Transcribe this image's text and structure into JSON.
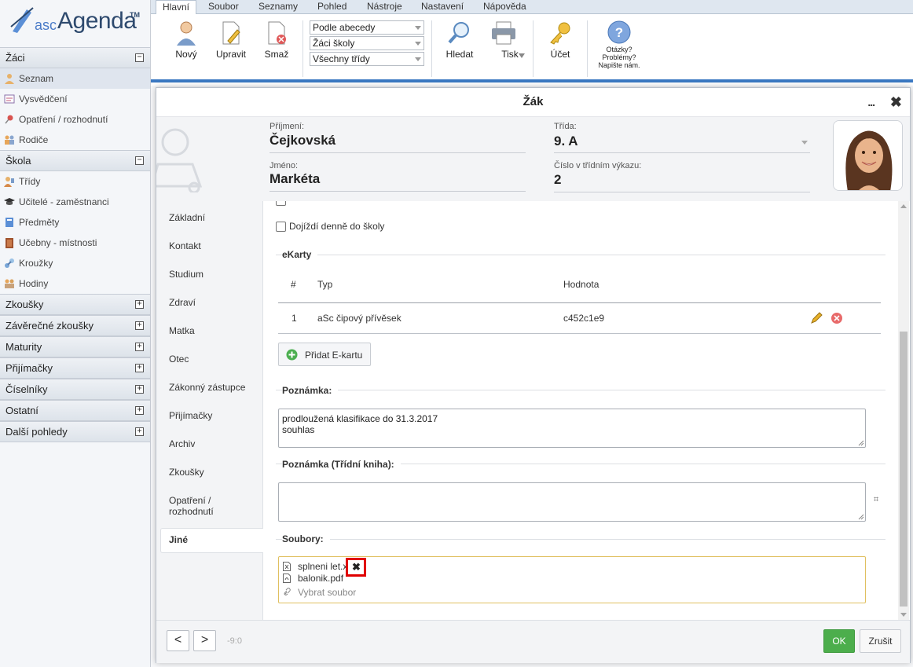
{
  "app": {
    "logo_prefix": "asc",
    "logo_name": "Agenda",
    "logo_tm": "TM"
  },
  "menu": [
    "Hlavní",
    "Soubor",
    "Seznamy",
    "Pohled",
    "Nástroje",
    "Nastavení",
    "Nápověda"
  ],
  "ribbon": {
    "new": "Nový",
    "edit": "Upravit",
    "delete": "Smaž",
    "sort_select": "Podle abecedy",
    "group_select": "Žáci školy",
    "class_select": "Všechny třídy",
    "search": "Hledat",
    "print": "Tisk",
    "account": "Účet",
    "help_line1": "Otázky?",
    "help_line2": "Problémy?",
    "help_line3": "Napište nám."
  },
  "sidebar": {
    "section1": "Žáci",
    "items1": [
      "Seznam",
      "Vysvědčení",
      "Opatření / rozhodnutí",
      "Rodiče"
    ],
    "section2": "Škola",
    "items2": [
      "Třídy",
      "Učitelé - zaměstnanci",
      "Předměty",
      "Učebny - místnosti",
      "Kroužky",
      "Hodiny"
    ],
    "collapsed": [
      "Zkoušky",
      "Závěrečné zkoušky",
      "Maturity",
      "Přijímačky",
      "Číselníky",
      "Ostatní",
      "Další pohledy"
    ]
  },
  "dialog": {
    "title": "Žák",
    "more": "...",
    "close": "✖",
    "header": {
      "surname_label": "Příjmení:",
      "surname": "Čejkovská",
      "name_label": "Jméno:",
      "name": "Markéta",
      "class_label": "Třída:",
      "class": "9. A",
      "number_label": "Číslo v třídním výkazu:",
      "number": "2"
    },
    "tabs": [
      "Základní",
      "Kontakt",
      "Studium",
      "Zdraví",
      "Matka",
      "Otec",
      "Zákonný zástupce",
      "Přijímačky",
      "Archiv",
      "Zkoušky",
      "Opatření / rozhodnutí",
      "Jiné"
    ],
    "active_tab": "Jiné",
    "commute_label": "Dojíždí denně do školy",
    "ekarty": {
      "legend": "eKarty",
      "columns": [
        "#",
        "Typ",
        "Hodnota"
      ],
      "rows": [
        {
          "num": "1",
          "type": "aSc čipový přívěsek",
          "value": "c452c1e9"
        }
      ],
      "add_button": "Přidat E-kartu"
    },
    "note_label": "Poznámka:",
    "note_line1": "prodloužená klasifikace do 31.3.2017",
    "note_line2": "souhlas",
    "note_class_label": "Poznámka (Třídní kniha):",
    "hash": "⌗",
    "files_label": "Soubory:",
    "files": [
      "splneni let.x",
      "balonik.pdf"
    ],
    "choose_file": "Vybrat soubor",
    "prev": "<",
    "next": ">",
    "position": "-9:0",
    "ok": "OK",
    "cancel": "Zrušit"
  }
}
